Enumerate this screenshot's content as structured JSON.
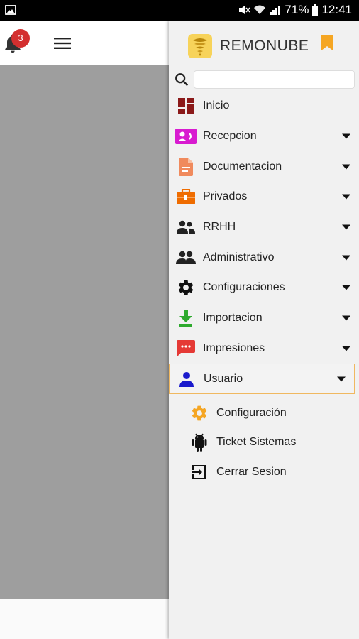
{
  "status_bar": {
    "battery": "71%",
    "time": "12:41"
  },
  "header": {
    "notification_count": "3"
  },
  "drawer": {
    "app_name": "REMONUBE",
    "search_placeholder": "",
    "menu": [
      {
        "label": "Inicio",
        "icon": "dashboard-icon",
        "color": "#8b1a1a",
        "has_caret": false
      },
      {
        "label": "Recepcion",
        "icon": "contact-card-icon",
        "color": "#d81bd0",
        "has_caret": true
      },
      {
        "label": "Documentacion",
        "icon": "document-icon",
        "color": "#f08a5d",
        "has_caret": true
      },
      {
        "label": "Privados",
        "icon": "briefcase-icon",
        "color": "#ef6c00",
        "has_caret": true
      },
      {
        "label": "RRHH",
        "icon": "people-icon",
        "color": "#222222",
        "has_caret": true
      },
      {
        "label": "Administrativo",
        "icon": "group-icon",
        "color": "#222222",
        "has_caret": true
      },
      {
        "label": "Configuraciones",
        "icon": "gear-icon",
        "color": "#111111",
        "has_caret": true
      },
      {
        "label": "Importacion",
        "icon": "download-icon",
        "color": "#2eaa2e",
        "has_caret": true
      },
      {
        "label": "Impresiones",
        "icon": "message-icon",
        "color": "#e53935",
        "has_caret": true
      },
      {
        "label": "Usuario",
        "icon": "person-icon",
        "color": "#1a1acc",
        "has_caret": true,
        "active": true
      }
    ],
    "submenu": [
      {
        "label": "Configuración",
        "icon": "gear-icon",
        "color": "#f5a623"
      },
      {
        "label": "Ticket Sistemas",
        "icon": "android-icon",
        "color": "#111111"
      },
      {
        "label": "Cerrar Sesion",
        "icon": "logout-icon",
        "color": "#111111"
      }
    ]
  }
}
